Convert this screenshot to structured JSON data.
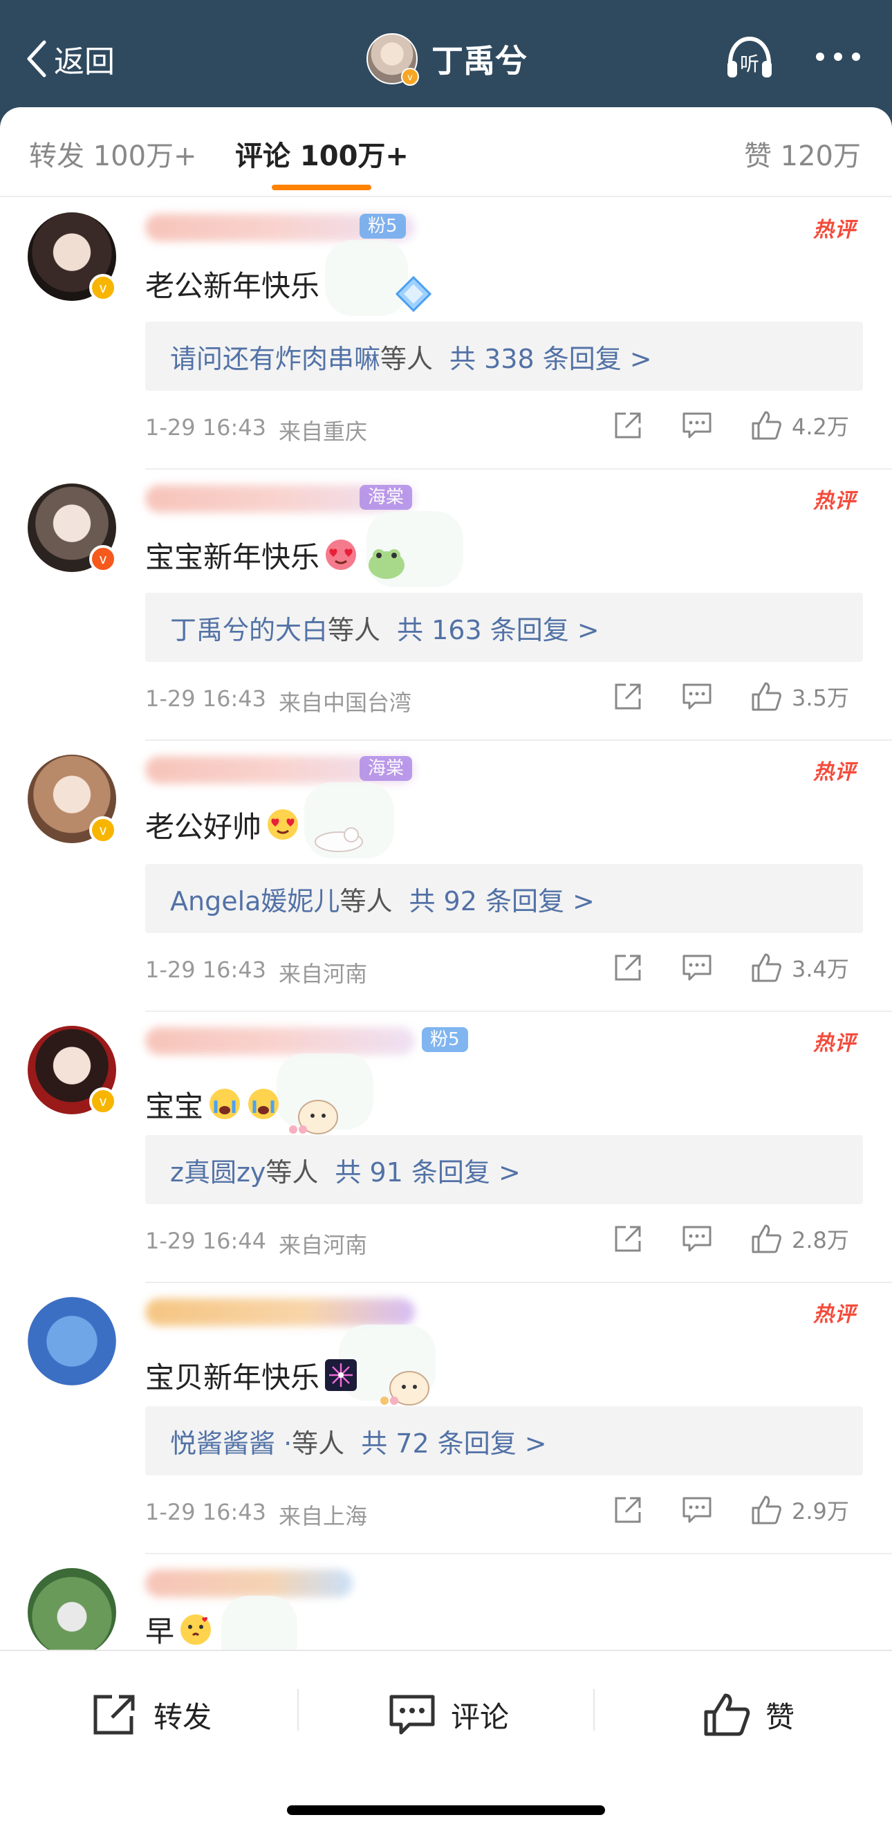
{
  "header": {
    "back_label": "返回",
    "title": "丁禹兮",
    "listen_label": "听"
  },
  "tabs": {
    "repost": "转发 100万+",
    "comments": "评论 100万+",
    "likes": "赞 120万"
  },
  "colors": {
    "header_bg": "#2f4a5f",
    "accent_orange": "#ff8200",
    "link_blue": "#5272a6",
    "hot_red": "#f44b3b"
  },
  "comments": [
    {
      "text": "老公新年快乐",
      "badge": "粉5",
      "hot": "热评",
      "reply_names": "请问还有炸肉串嘛",
      "reply_suffix": "等人",
      "reply_count": "共 338 条回复 >",
      "time": "1-29 16:43",
      "location": "来自重庆",
      "likes": "4.2万"
    },
    {
      "text": "宝宝新年快乐",
      "badge": "海棠",
      "hot": "热评",
      "reply_names": "丁禹兮的大白",
      "reply_suffix": "等人",
      "reply_count": "共 163 条回复 >",
      "time": "1-29 16:43",
      "location": "来自中国台湾",
      "likes": "3.5万"
    },
    {
      "text": "老公好帅",
      "badge": "海棠",
      "hot": "热评",
      "reply_names": "Angela媛妮儿",
      "reply_suffix": "等人",
      "reply_count": "共 92 条回复 >",
      "time": "1-29 16:43",
      "location": "来自河南",
      "likes": "3.4万"
    },
    {
      "text": "宝宝",
      "badge": "粉5",
      "hot": "热评",
      "reply_names": "z真圆zy",
      "reply_suffix": "等人",
      "reply_count": "共 91 条回复 >",
      "time": "1-29 16:44",
      "location": "来自河南",
      "likes": "2.8万"
    },
    {
      "text": "宝贝新年快乐",
      "badge": "",
      "hot": "热评",
      "reply_names": "悦酱酱酱 ·",
      "reply_suffix": "等人",
      "reply_count": "共 72 条回复 >",
      "time": "1-29 16:43",
      "location": "来自上海",
      "likes": "2.9万"
    },
    {
      "text": "早"
    }
  ],
  "bottom_bar": {
    "repost": "转发",
    "comment": "评论",
    "like": "赞"
  }
}
